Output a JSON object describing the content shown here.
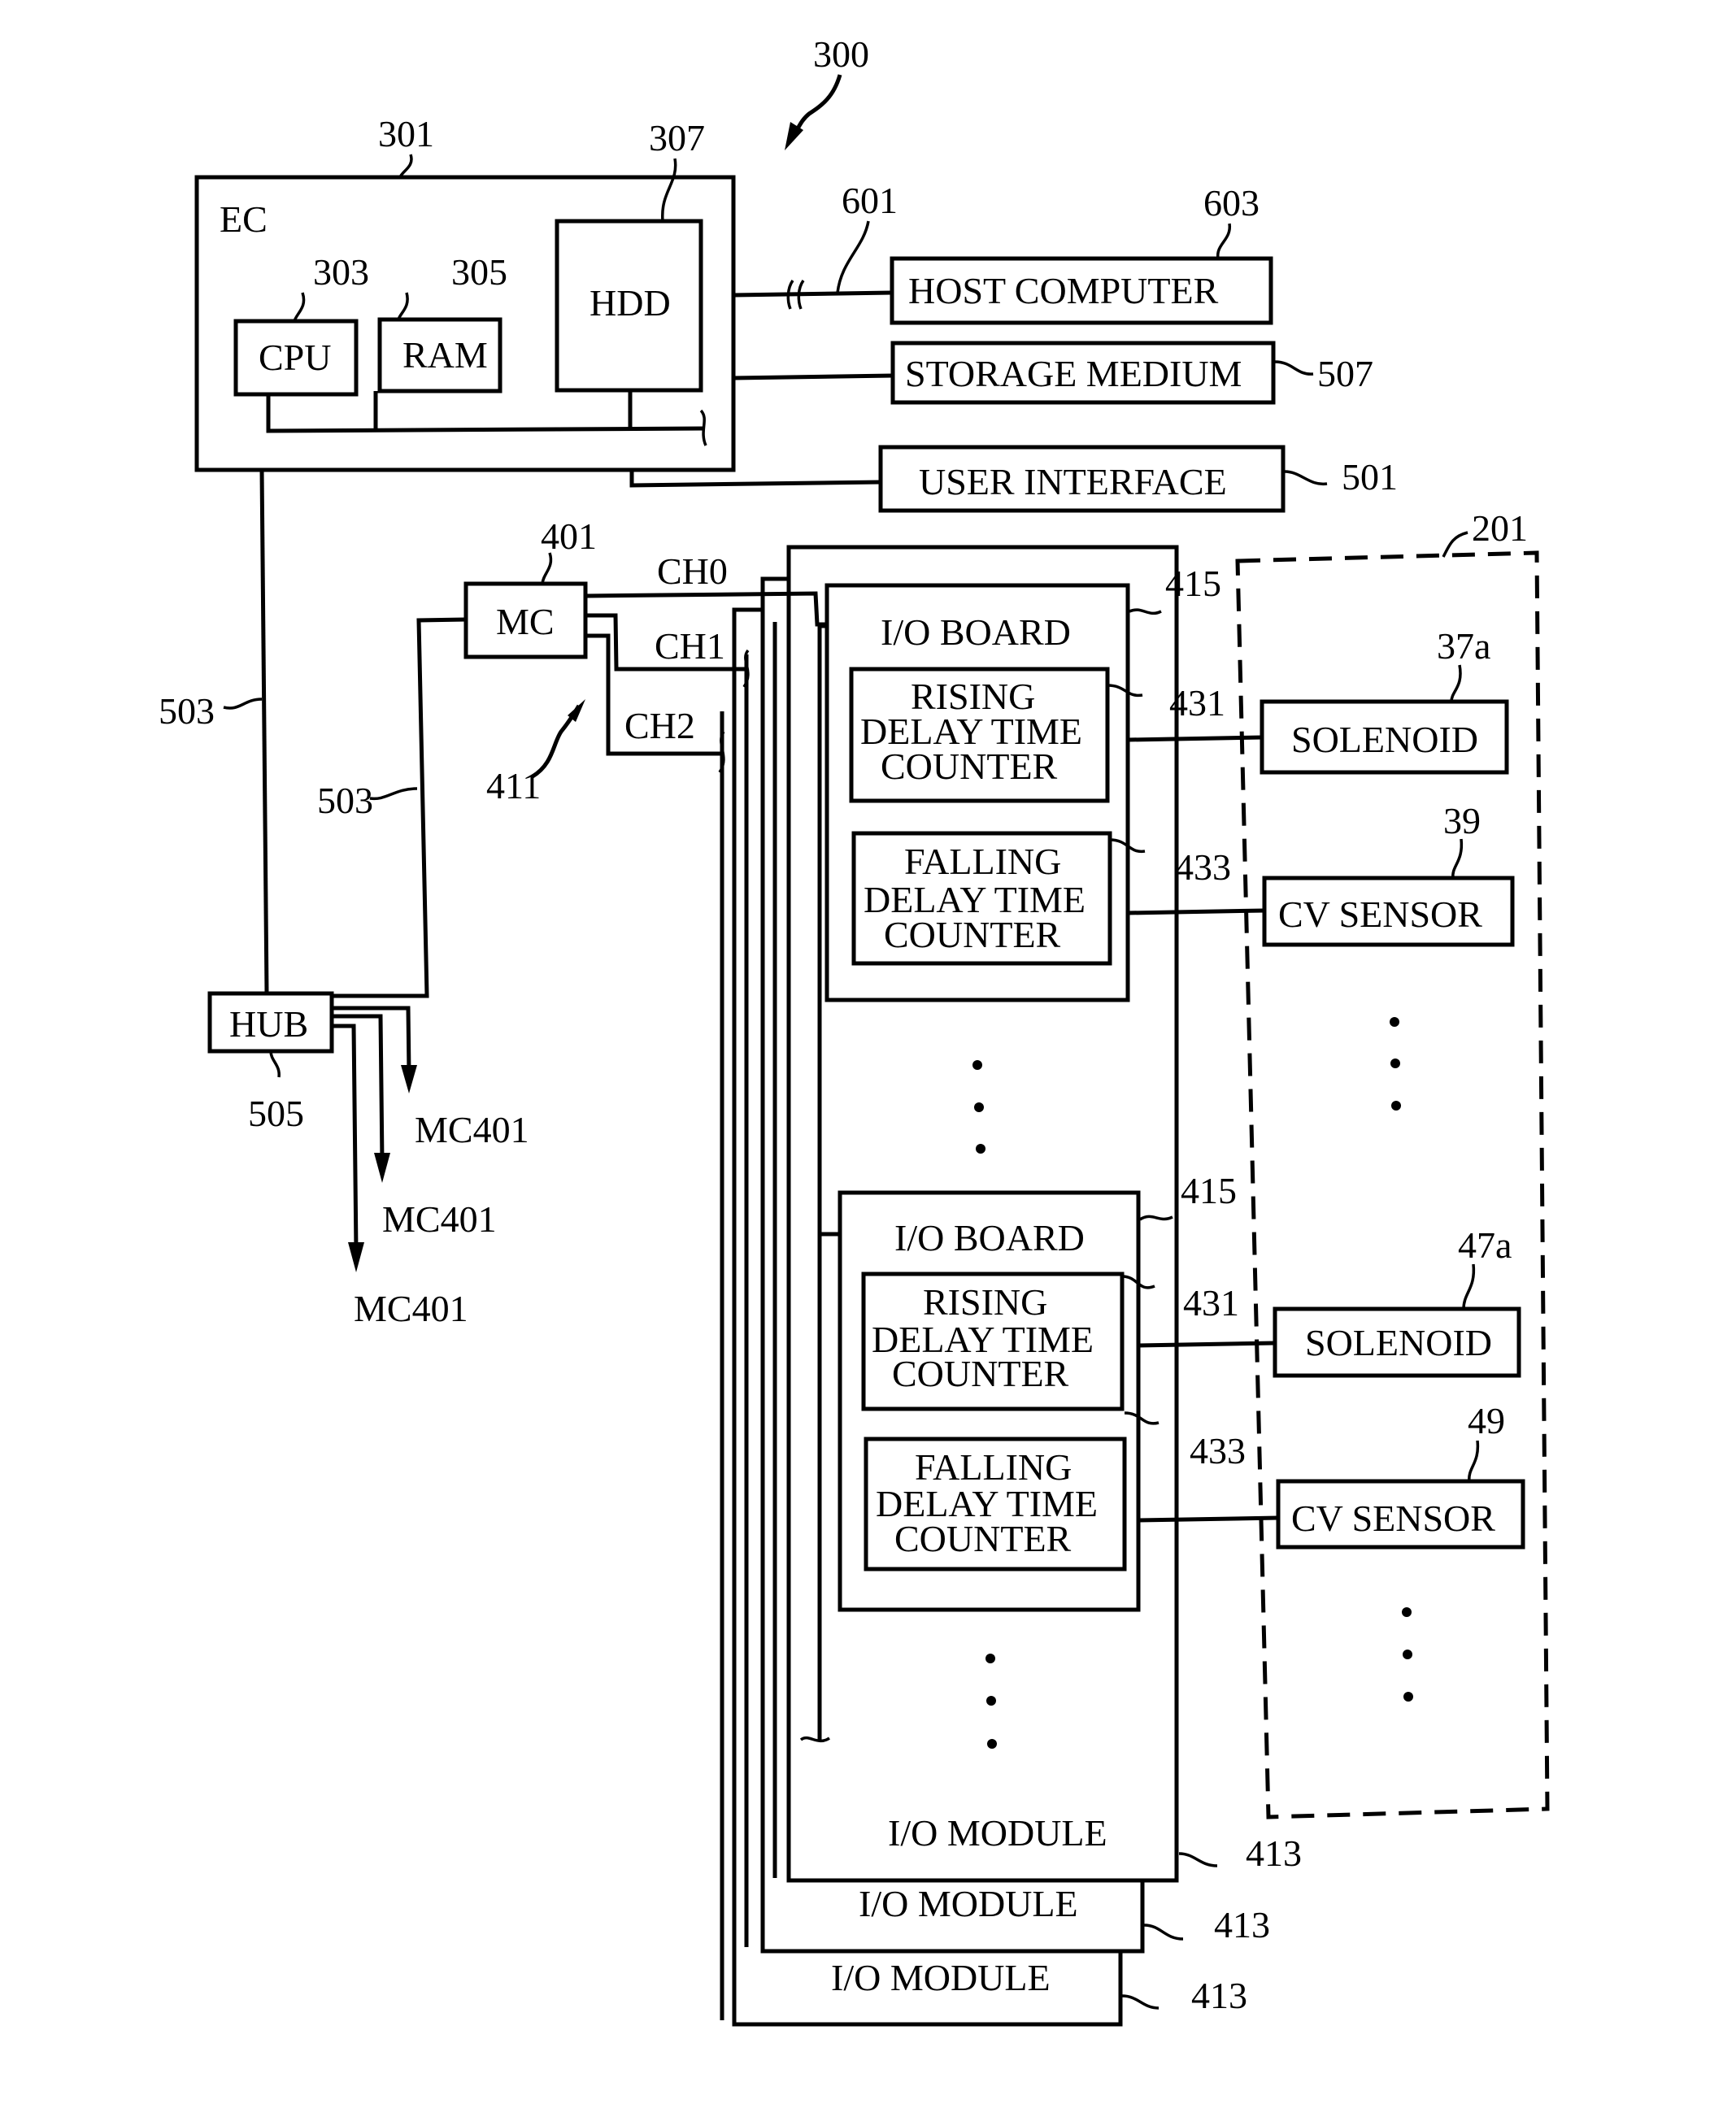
{
  "figure": {
    "ref": "300",
    "ec": {
      "title": "EC",
      "ref": "301",
      "cpu": {
        "label": "CPU",
        "ref": "303"
      },
      "ram": {
        "label": "RAM",
        "ref": "305"
      },
      "hdd": {
        "label": "HDD",
        "ref": "307"
      }
    },
    "host_computer": {
      "label": "HOST COMPUTER",
      "ref": "603",
      "link_ref": "601"
    },
    "storage_medium": {
      "label": "STORAGE MEDIUM",
      "ref": "507"
    },
    "user_interface": {
      "label": "USER INTERFACE",
      "ref": "501"
    },
    "mc": {
      "label": "MC",
      "ref": "401"
    },
    "channels": [
      "CH0",
      "CH1",
      "CH2"
    ],
    "channel_bus_ref": "411",
    "network_refs": [
      "503",
      "503"
    ],
    "hub": {
      "label": "HUB",
      "ref": "505",
      "outputs": [
        "MC401",
        "MC401",
        "MC401"
      ]
    },
    "device_group_ref": "201",
    "io_boards": [
      {
        "label": "I/O BOARD",
        "ref": "415",
        "rising": {
          "lines": [
            "RISING",
            "DELAY TIME",
            "COUNTER"
          ],
          "ref": "431"
        },
        "falling": {
          "lines": [
            "FALLING",
            "DELAY TIME",
            "COUNTER"
          ],
          "ref": "433"
        },
        "solenoid": {
          "label": "SOLENOID",
          "ref": "37a"
        },
        "cv_sensor": {
          "label": "CV SENSOR",
          "ref": "39"
        }
      },
      {
        "label": "I/O BOARD",
        "ref": "415",
        "rising": {
          "lines": [
            "RISING",
            "DELAY TIME",
            "COUNTER"
          ],
          "ref": "431"
        },
        "falling": {
          "lines": [
            "FALLING",
            "DELAY TIME",
            "COUNTER"
          ],
          "ref": "433"
        },
        "solenoid": {
          "label": "SOLENOID",
          "ref": "47a"
        },
        "cv_sensor": {
          "label": "CV SENSOR",
          "ref": "49"
        }
      }
    ],
    "io_modules": [
      {
        "label": "I/O MODULE",
        "ref": "413"
      },
      {
        "label": "I/O MODULE",
        "ref": "413"
      },
      {
        "label": "I/O MODULE",
        "ref": "413"
      }
    ]
  }
}
